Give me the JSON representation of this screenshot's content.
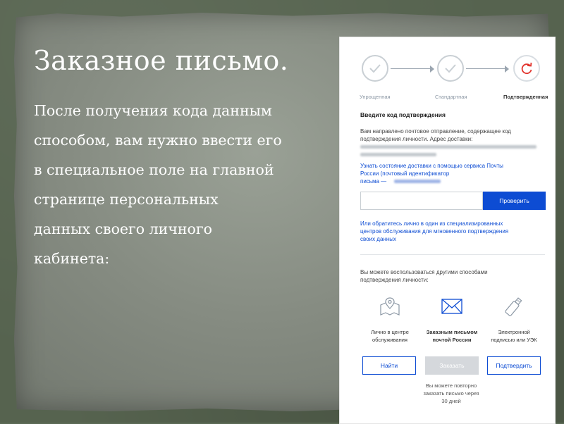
{
  "slide": {
    "title": "Заказное письмо.",
    "body_lines": [
      "После получения кода данным",
      "способом, вам нужно ввести его",
      " в специальное поле на главной",
      "странице персональных",
      "данных своего личного",
      "кабинета:"
    ]
  },
  "screenshot": {
    "steps": [
      {
        "label": "Упрощенная",
        "state": "done",
        "icon": "check-icon"
      },
      {
        "label": "Стандартная",
        "state": "done",
        "icon": "check-icon"
      },
      {
        "label": "Подтвержденная",
        "state": "active",
        "icon": "refresh-icon"
      }
    ],
    "code_heading": "Введите код подтверждения",
    "sent_text_1": "Вам направлено почтовое отправление, содержащее код",
    "sent_text_2": "подтверждения личности. Адрес доставки:",
    "track_link_1": "Узнать состояние доставки с помощью сервиса Почты",
    "track_link_2": "России (почтовый идентификатор",
    "track_link_3": "письма —",
    "code_input_value": "",
    "check_button": "Проверить",
    "in_person_link_1": "Или обратитесь лично в один из специализированных",
    "in_person_link_2": "центров обслуживания для мгновенного подтверждения",
    "in_person_link_3": "своих данных",
    "other_methods_1": "Вы можете воспользоваться другими способами",
    "other_methods_2": "подтверждения личности:",
    "methods": [
      {
        "label_1": "Лично в центре",
        "label_2": "обслуживания",
        "icon": "map-pin-icon"
      },
      {
        "label_1": "Заказным письмом",
        "label_2": "почтой России",
        "icon": "envelope-icon"
      },
      {
        "label_1": "Электронной",
        "label_2": "подписью или УЭК",
        "icon": "usb-key-icon"
      }
    ],
    "buttons": {
      "find": "Найти",
      "order": "Заказать",
      "confirm": "Подтвердить"
    },
    "retry_note_1": "Вы можете повторно",
    "retry_note_2": "заказать письмо через",
    "retry_note_3": "30 дней"
  },
  "colors": {
    "accent": "#0d4cd3",
    "active_step": "#e2342d",
    "done_step": "#c9cfd4",
    "disabled": "#d5d8dc"
  }
}
